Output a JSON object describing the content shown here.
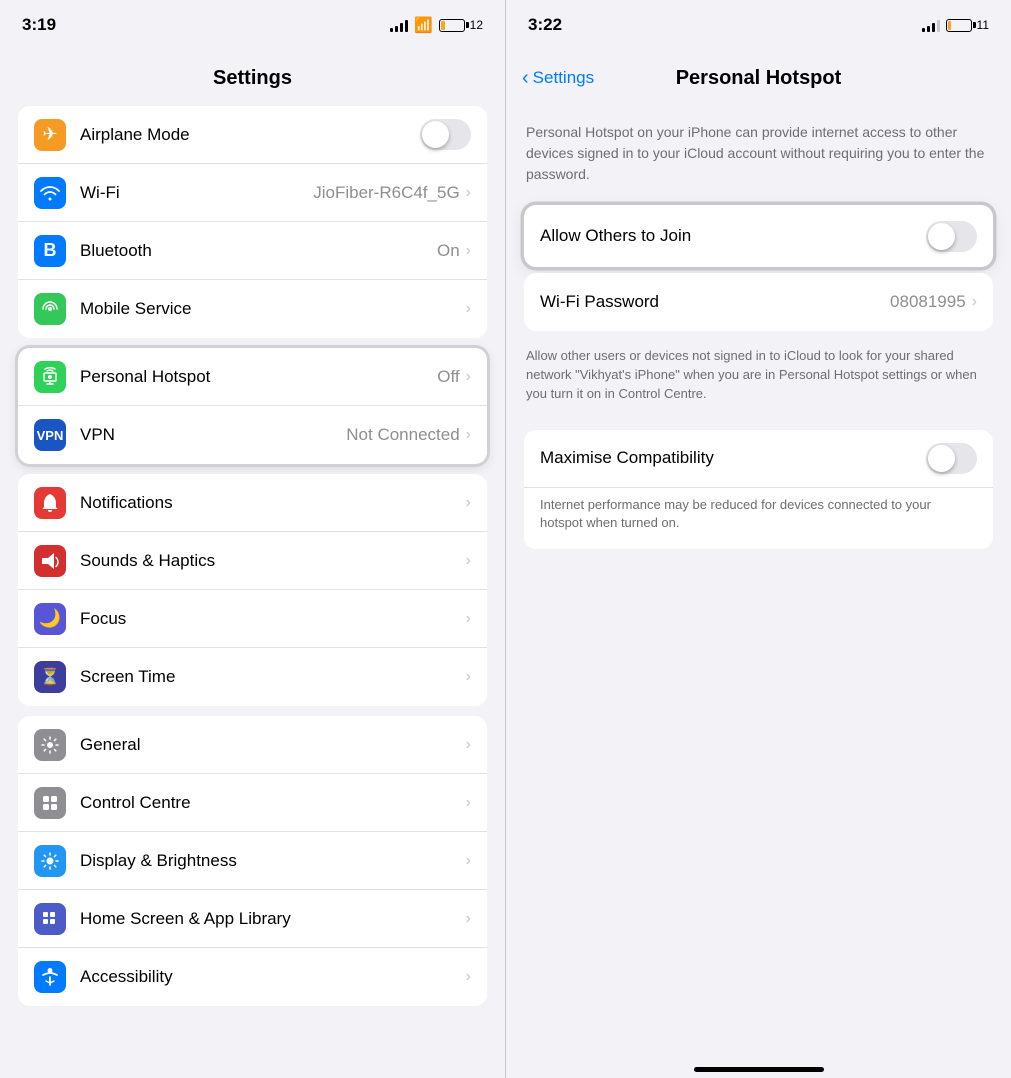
{
  "left": {
    "status": {
      "time": "3:19",
      "battery": "12"
    },
    "title": "Settings",
    "groups": [
      {
        "id": "connectivity",
        "items": [
          {
            "id": "airplane-mode",
            "icon": "✈",
            "icon_bg": "orange",
            "label": "Airplane Mode",
            "value": "",
            "type": "toggle",
            "toggle_on": false
          },
          {
            "id": "wifi",
            "icon": "wifi",
            "icon_bg": "blue",
            "label": "Wi-Fi",
            "value": "JioFiber-R6C4f_5G",
            "type": "chevron"
          },
          {
            "id": "bluetooth",
            "icon": "bt",
            "icon_bg": "blue",
            "label": "Bluetooth",
            "value": "On",
            "type": "chevron"
          },
          {
            "id": "mobile-service",
            "icon": "mobile",
            "icon_bg": "green",
            "label": "Mobile Service",
            "value": "",
            "type": "chevron"
          }
        ]
      },
      {
        "id": "hotspot-vpn",
        "highlighted": true,
        "items": [
          {
            "id": "personal-hotspot",
            "icon": "hotspot",
            "icon_bg": "green-bright",
            "label": "Personal Hotspot",
            "value": "Off",
            "type": "chevron",
            "highlighted": true
          },
          {
            "id": "vpn",
            "icon": "globe",
            "icon_bg": "blue-dark",
            "label": "VPN",
            "value": "Not Connected",
            "type": "chevron"
          }
        ]
      },
      {
        "id": "system",
        "items": [
          {
            "id": "notifications",
            "icon": "notif",
            "icon_bg": "red",
            "label": "Notifications",
            "value": "",
            "type": "chevron"
          },
          {
            "id": "sounds",
            "icon": "sound",
            "icon_bg": "red-dark",
            "label": "Sounds & Haptics",
            "value": "",
            "type": "chevron"
          },
          {
            "id": "focus",
            "icon": "moon",
            "icon_bg": "purple",
            "label": "Focus",
            "value": "",
            "type": "chevron"
          },
          {
            "id": "screen-time",
            "icon": "hourglass",
            "icon_bg": "purple-dark",
            "label": "Screen Time",
            "value": "",
            "type": "chevron"
          }
        ]
      },
      {
        "id": "general-settings",
        "items": [
          {
            "id": "general",
            "icon": "gear",
            "icon_bg": "gray",
            "label": "General",
            "value": "",
            "type": "chevron"
          },
          {
            "id": "control-centre",
            "icon": "sliders",
            "icon_bg": "gray",
            "label": "Control Centre",
            "value": "",
            "type": "chevron"
          },
          {
            "id": "display",
            "icon": "sun",
            "icon_bg": "blue-light",
            "label": "Display & Brightness",
            "value": "",
            "type": "chevron"
          },
          {
            "id": "home-screen",
            "icon": "grid",
            "icon_bg": "indigo",
            "label": "Home Screen & App Library",
            "value": "",
            "type": "chevron"
          },
          {
            "id": "accessibility",
            "icon": "person",
            "icon_bg": "blue",
            "label": "Accessibility",
            "value": "",
            "type": "chevron"
          }
        ]
      }
    ]
  },
  "right": {
    "status": {
      "time": "3:22",
      "battery": "11"
    },
    "back_label": "Settings",
    "title": "Personal Hotspot",
    "description": "Personal Hotspot on your iPhone can provide internet access to other devices signed in to your iCloud account without requiring you to enter the password.",
    "allow_join": {
      "label": "Allow Others to Join",
      "toggle_on": false
    },
    "wifi_password": {
      "label": "Wi-Fi Password",
      "value": "08081995"
    },
    "icloud_description": "Allow other users or devices not signed in to iCloud to look for your shared network \"Vikhyat's iPhone\" when you are in Personal Hotspot settings or when you turn it on in Control Centre.",
    "maximise_compat": {
      "label": "Maximise Compatibility",
      "toggle_on": false
    },
    "compat_description": "Internet performance may be reduced for devices connected to your hotspot when turned on."
  }
}
